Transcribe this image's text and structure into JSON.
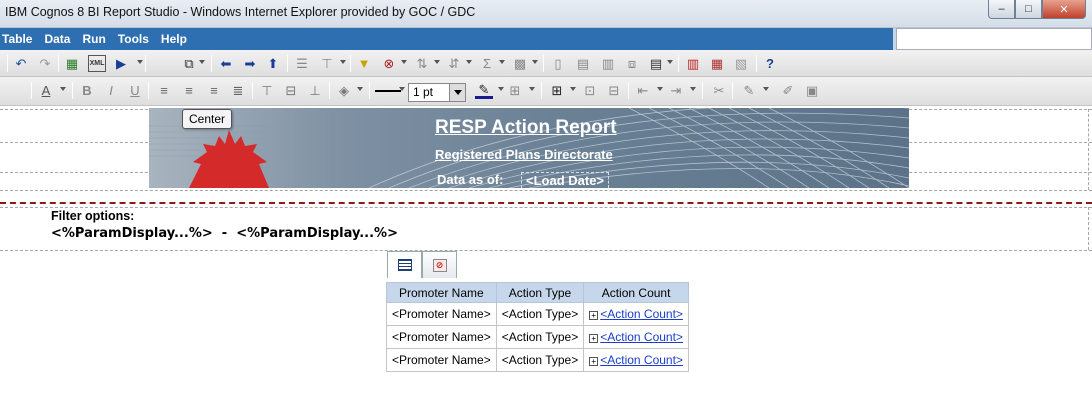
{
  "window": {
    "title": "IBM Cognos 8 BI Report Studio - Windows Internet Explorer provided by GOC / GDC",
    "controls": {
      "minimize": "–",
      "maximize": "□",
      "close": "✕"
    }
  },
  "menu": [
    "Table",
    "Data",
    "Run",
    "Tools",
    "Help"
  ],
  "toolbar2": {
    "line_width": "1 pt"
  },
  "tooltip": "Center",
  "banner": {
    "title": "RESP Action Report",
    "subtitle": "Registered Plans Directorate",
    "data_as_of_label": "Data as of:",
    "data_as_of_value": "<Load Date>"
  },
  "filters": {
    "label": "Filter options:",
    "param_text": "<%ParamDisplay...%>  -  <%ParamDisplay...%>"
  },
  "table": {
    "headers": [
      "Promoter Name",
      "Action Type",
      "Action Count"
    ],
    "rows": [
      [
        "<Promoter Name>",
        "<Action Type>",
        "<Action Count>"
      ],
      [
        "<Promoter Name>",
        "<Action Type>",
        "<Action Count>"
      ],
      [
        "<Promoter Name>",
        "<Action Type>",
        "<Action Count>"
      ]
    ]
  },
  "colors": {
    "menubar": "#2d6fb0",
    "header_cell": "#c6d7ec",
    "link": "#1a3dcc",
    "leaf_red": "#d42a2a"
  }
}
